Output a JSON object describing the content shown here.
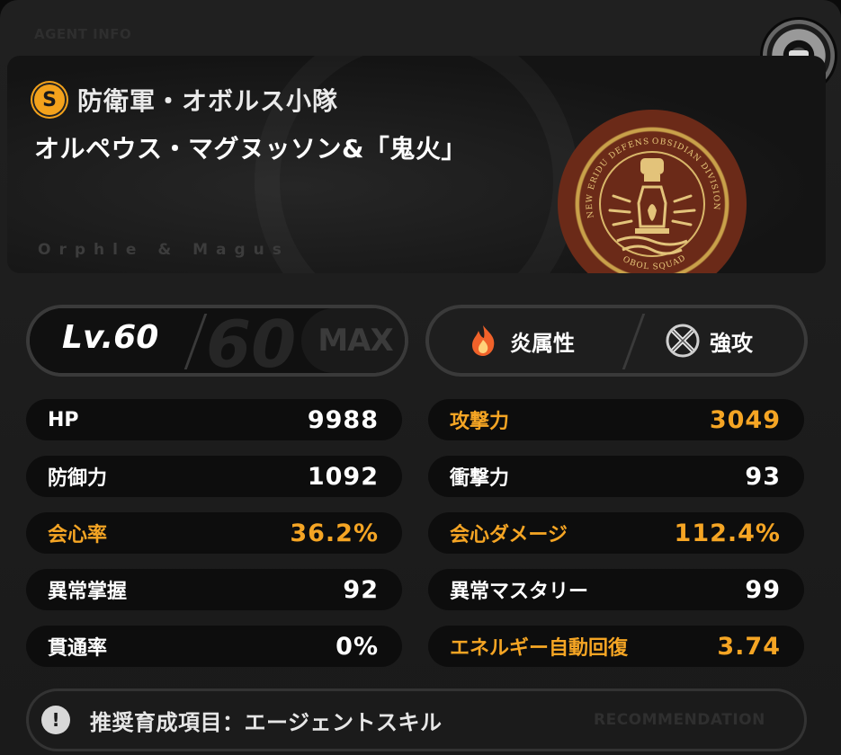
{
  "header": {
    "section_tag": "AGENT INFO"
  },
  "agent": {
    "rank": "S",
    "faction": "防衛軍・オボルス小隊",
    "name": "オルペウス・マグヌッソン&「鬼火」",
    "roman_name": "Orphle & Magus",
    "emblem": {
      "outer_text_left": "NEW ERIDU DEFENSE FORCE",
      "outer_text_right": "OBSIDIAN DIVISION",
      "bottom_text": "OBOL SQUAD"
    }
  },
  "level": {
    "label": "Lv.60",
    "max_level": "60",
    "max_label": "MAX"
  },
  "attributes": {
    "element": {
      "label": "炎属性",
      "icon": "fire-icon",
      "color": "#f0622a"
    },
    "specialty": {
      "label": "強攻",
      "icon": "strike-icon"
    }
  },
  "stats": {
    "left": [
      {
        "name": "HP",
        "value": "9988",
        "highlight": false
      },
      {
        "name": "防御力",
        "value": "1092",
        "highlight": false
      },
      {
        "name": "会心率",
        "value": "36.2%",
        "highlight": true
      },
      {
        "name": "異常掌握",
        "value": "92",
        "highlight": false
      },
      {
        "name": "貫通率",
        "value": "0%",
        "highlight": false
      }
    ],
    "right": [
      {
        "name": "攻撃力",
        "value": "3049",
        "highlight": true
      },
      {
        "name": "衝撃力",
        "value": "93",
        "highlight": false
      },
      {
        "name": "会心ダメージ",
        "value": "112.4%",
        "highlight": true
      },
      {
        "name": "異常マスタリー",
        "value": "99",
        "highlight": false
      },
      {
        "name": "エネルギー自動回復",
        "value": "3.74",
        "highlight": true
      }
    ],
    "highlight_color": "#f5a524"
  },
  "recommendation": {
    "icon": "alert-icon",
    "text": "推奨育成項目：エージェントスキル",
    "tag": "RECOMMENDATION"
  }
}
